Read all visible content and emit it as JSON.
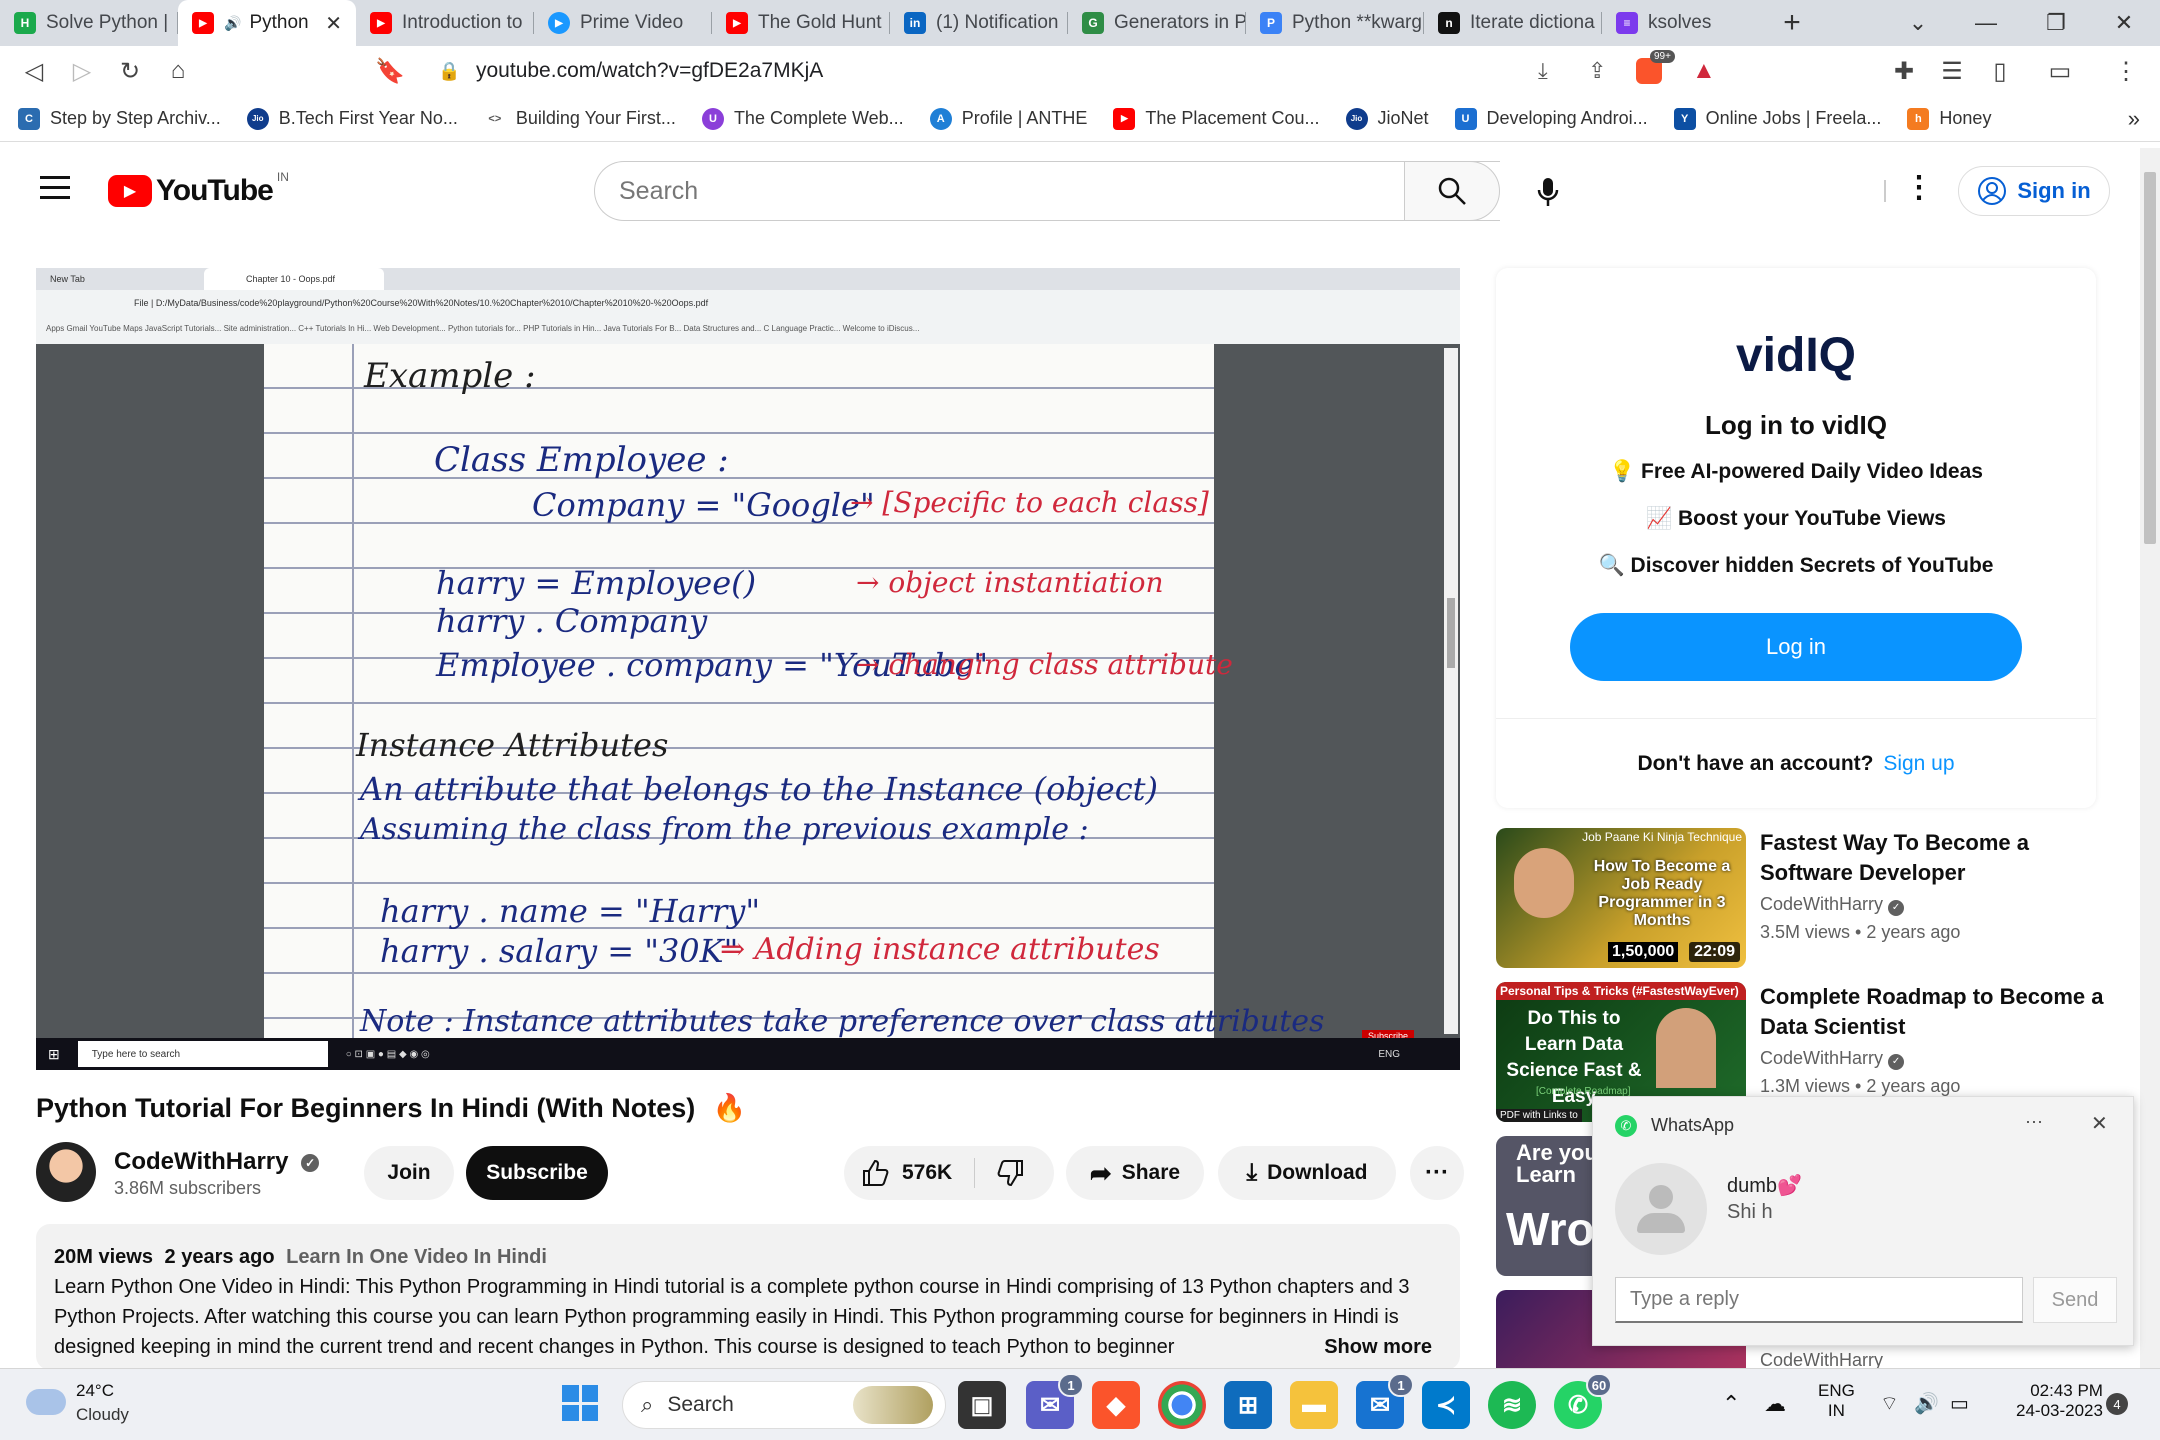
{
  "browser": {
    "tabs": [
      {
        "label": "Solve Python |",
        "icon_color": "#1ba94c",
        "icon_text": "H"
      },
      {
        "label": "Python",
        "icon_color": "#ff0000",
        "icon_text": "▶",
        "active": true
      },
      {
        "label": "Introduction to",
        "icon_color": "#ff0000",
        "icon_text": "▶"
      },
      {
        "label": "Prime Video",
        "icon_color": "#1a98ff",
        "icon_text": "▶"
      },
      {
        "label": "The Gold Hunt",
        "icon_color": "#ff0000",
        "icon_text": "▶"
      },
      {
        "label": "(1) Notification",
        "icon_color": "#0a66c2",
        "icon_text": "in"
      },
      {
        "label": "Generators in P",
        "icon_color": "#2f8d46",
        "icon_text": "G"
      },
      {
        "label": "Python **kwarg",
        "icon_color": "#3b82f6",
        "icon_text": "P"
      },
      {
        "label": "Iterate dictiona",
        "icon_color": "#111111",
        "icon_text": "n"
      },
      {
        "label": "ksolves",
        "icon_color": "#7c3aed",
        "icon_text": "≡"
      }
    ],
    "new_tab": "+",
    "url": "youtube.com/watch?v=gfDE2a7MKjA",
    "brave_badge": "99+",
    "bookmarks": [
      {
        "label": "Step by Step Archiv...",
        "color": "#2b6cb0",
        "icon": "C"
      },
      {
        "label": "B.Tech First Year No...",
        "color": "#0f3c8c",
        "icon": "Jio"
      },
      {
        "label": "Building Your First...",
        "color": "#555555",
        "icon": "<>"
      },
      {
        "label": "The Complete Web...",
        "color": "#8b3fd9",
        "icon": "U"
      },
      {
        "label": "Profile | ANTHE",
        "color": "#1f7fd6",
        "icon": "A"
      },
      {
        "label": "The Placement Cou...",
        "color": "#ff0000",
        "icon": "▶"
      },
      {
        "label": "JioNet",
        "color": "#0f3c8c",
        "icon": "Jio"
      },
      {
        "label": "Developing Androi...",
        "color": "#1c6fd1",
        "icon": "U"
      },
      {
        "label": "Online Jobs | Freela...",
        "color": "#0d4fa3",
        "icon": "Y"
      },
      {
        "label": "Honey",
        "color": "#f47b20",
        "icon": "h"
      }
    ],
    "more": "»"
  },
  "youtube": {
    "logo": "YouTube",
    "region": "IN",
    "search_placeholder": "Search",
    "sign_in": "Sign in"
  },
  "video": {
    "title": "Python Tutorial For Beginners In Hindi (With Notes)",
    "fire": "🔥",
    "channel": "CodeWithHarry",
    "subscribers": "3.86M subscribers",
    "join": "Join",
    "subscribe": "Subscribe",
    "likes": "576K",
    "share": "Share",
    "download": "Download",
    "more": "···",
    "views": "20M views",
    "age": "2 years ago",
    "playlist": "Learn In One Video In Hindi",
    "description": "Learn Python One Video in Hindi: This Python Programming in Hindi tutorial is a complete python course in Hindi comprising of 13 Python chapters and 3 Python Projects. After watching this course you can learn Python programming easily in Hindi. This Python programming course for beginners in Hindi is designed keeping in mind the current trend and recent changes in Python. This course is designed to teach Python to beginner",
    "show_more": "Show more"
  },
  "inner_screen": {
    "tab1": "New Tab",
    "tab2": "Chapter 10 - Oops.pdf",
    "path": "File | D:/MyData/Business/code%20playground/Python%20Course%20With%20Notes/10.%20Chapter%2010/Chapter%2010%20-%20Oops.pdf",
    "bookmarks": "Apps   Gmail   YouTube   Maps   JavaScript Tutorials...   Site administration...   C++ Tutorials In Hi...   Web Development...   Python tutorials for...   PHP Tutorials in Hin...   Java Tutorials For B...   Data Structures and...   C Language Practic...   Welcome to iDiscus...",
    "search": "Type here to search",
    "subscribe_tag": "Subscribe",
    "lang": "ENG",
    "notes": [
      {
        "text": "Example :",
        "color": "k"
      },
      {
        "text": "Class  Employee :",
        "color": "b"
      },
      {
        "text": "Company = \"Google\"",
        "color": "b"
      },
      {
        "text": "→ [Specific to each class]",
        "color": "r"
      },
      {
        "text": "harry = Employee()",
        "color": "b"
      },
      {
        "text": "→ object instantiation",
        "color": "r"
      },
      {
        "text": "harry . Company",
        "color": "b"
      },
      {
        "text": "Employee . company = \"YouTube\"",
        "color": "b"
      },
      {
        "text": "→ changing class attribute",
        "color": "r"
      },
      {
        "text": "Instance Attributes",
        "color": "k"
      },
      {
        "text": "An attribute that belongs to the Instance (object)",
        "color": "b"
      },
      {
        "text": "Assuming the class from the previous example :",
        "color": "b"
      },
      {
        "text": "harry . name = \"Harry\"",
        "color": "b"
      },
      {
        "text": "harry . salary = \"30K\"",
        "color": "b"
      },
      {
        "text": "⇒ Adding instance attributes",
        "color": "r"
      },
      {
        "text": "Note : Instance attributes take preference over class attributes",
        "color": "b"
      }
    ]
  },
  "vidiq": {
    "logo": "vidIQ",
    "heading": "Log in to vidIQ",
    "features": [
      "💡 Free AI-powered Daily Video Ideas",
      "📈 Boost your YouTube Views",
      "🔍 Discover hidden Secrets of YouTube"
    ],
    "login": "Log in",
    "no_account": "Don't have an account?",
    "sign_up": "Sign up"
  },
  "recommendations": [
    {
      "title": "Fastest Way To Become a Software Developer",
      "channel": "CodeWithHarry",
      "views": "3.5M views",
      "age": "2 years ago",
      "thumb_top": "Job Paane Ki Ninja Technique",
      "thumb_text": "How To Become a Job Ready Programmer in 3 Months",
      "thumb_views": "1,50,000",
      "duration": "22:09"
    },
    {
      "title": "Complete Roadmap to Become a Data Scientist",
      "channel": "CodeWithHarry",
      "views": "1.3M views",
      "age": "2 years ago",
      "thumb_top": "Personal Tips & Tricks (#FastestWayEver)",
      "thumb_text": "Do This to Learn Data Science Fast & Easy",
      "thumb_sub": "[Complete Roadmap]",
      "thumb_foot": "PDF with Links to"
    },
    {
      "thumb_text": "Are you Learn",
      "thumb_big": "Wro"
    },
    {
      "channel": "CodeWithHarry"
    }
  ],
  "whatsapp": {
    "app": "WhatsApp",
    "dots": "···",
    "sender": "dumb💕",
    "message": "Shi h",
    "reply_placeholder": "Type a reply",
    "send": "Send"
  },
  "taskbar": {
    "temp": "24°C",
    "weather": "Cloudy",
    "search": "Search",
    "lang1": "ENG",
    "lang2": "IN",
    "time": "02:43 PM",
    "date": "24-03-2023",
    "notif": "4",
    "badges": {
      "teams": "1",
      "mail": "1",
      "whatsapp": "60"
    }
  }
}
